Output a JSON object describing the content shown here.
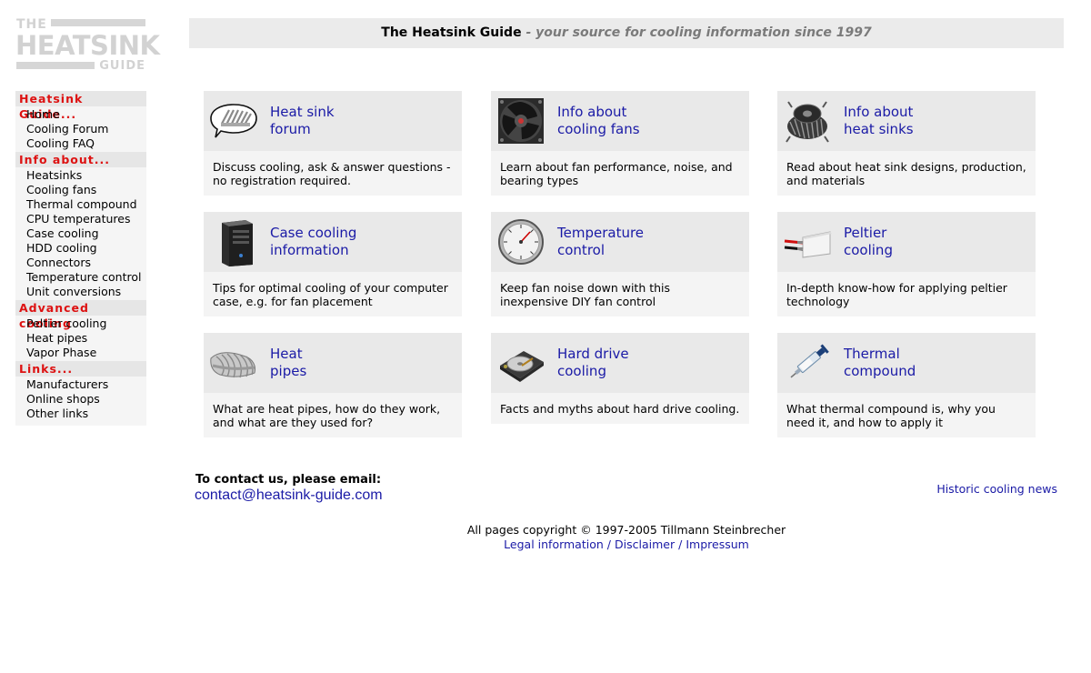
{
  "logo": {
    "line1": "THE",
    "line2": "HEATSINK",
    "line3": "GUIDE"
  },
  "header": {
    "site_name": "The Heatsink Guide",
    "tagline": " - your source for cooling information since 1997"
  },
  "sidebar": {
    "sections": [
      {
        "heading": "Heatsink Guide...",
        "items": [
          "Home",
          "Cooling Forum",
          "Cooling FAQ"
        ]
      },
      {
        "heading": "Info about...",
        "items": [
          "Heatsinks",
          "Cooling fans",
          "Thermal compound",
          "CPU temperatures",
          "Case cooling",
          "HDD cooling",
          "Connectors",
          "Temperature control",
          "Unit conversions"
        ]
      },
      {
        "heading": "Advanced cooling",
        "items": [
          "Peltier cooling",
          "Heat pipes",
          "Vapor Phase"
        ]
      },
      {
        "heading": "Links...",
        "items": [
          "Manufacturers",
          "Online shops",
          "Other links"
        ]
      }
    ]
  },
  "cards": [
    {
      "title_l1": "Heat sink",
      "title_l2": "forum",
      "desc": "Discuss cooling, ask & answer questions - no registration required.",
      "icon": "speech-bubble-heatsink-icon"
    },
    {
      "title_l1": "Info about",
      "title_l2": "cooling fans",
      "desc": "Learn about fan performance, noise, and bearing types",
      "icon": "fan-icon"
    },
    {
      "title_l1": "Info about",
      "title_l2": "heat sinks",
      "desc": "Read about heat sink designs, production, and materials",
      "icon": "heatsink-icon"
    },
    {
      "title_l1": "Case cooling",
      "title_l2": "information",
      "desc": "Tips for optimal cooling of your computer case, e.g. for fan placement",
      "icon": "computer-case-icon"
    },
    {
      "title_l1": "Temperature",
      "title_l2": "control",
      "desc": "Keep fan noise down with this inexpensive DIY fan control",
      "icon": "gauge-icon"
    },
    {
      "title_l1": "Peltier",
      "title_l2": "cooling",
      "desc": "In-depth know-how for applying peltier technology",
      "icon": "peltier-module-icon"
    },
    {
      "title_l1": "Heat",
      "title_l2": "pipes",
      "desc": "What are heat pipes, how do they work, and what are they used for?",
      "icon": "heat-pipe-icon"
    },
    {
      "title_l1": "Hard drive",
      "title_l2": "cooling",
      "desc": "Facts and myths about hard drive cooling.",
      "icon": "hard-drive-icon"
    },
    {
      "title_l1": "Thermal",
      "title_l2": "compound",
      "desc": "What thermal compound is, why you need it, and how to apply it",
      "icon": "syringe-icon"
    }
  ],
  "contact": {
    "label": "To contact us, please email:",
    "email": "contact@heatsink-guide.com"
  },
  "news_link": "Historic cooling news",
  "footer": {
    "copyright": "All pages copyright © 1997-2005 Tillmann Steinbrecher",
    "links": [
      "Legal information",
      "Disclaimer",
      "Impressum"
    ],
    "separator": "/"
  },
  "colors": {
    "link": "#1a1aa6",
    "section_heading": "#dd1111",
    "card_top": "#e9e9e9",
    "card_body": "#f4f4f4"
  }
}
